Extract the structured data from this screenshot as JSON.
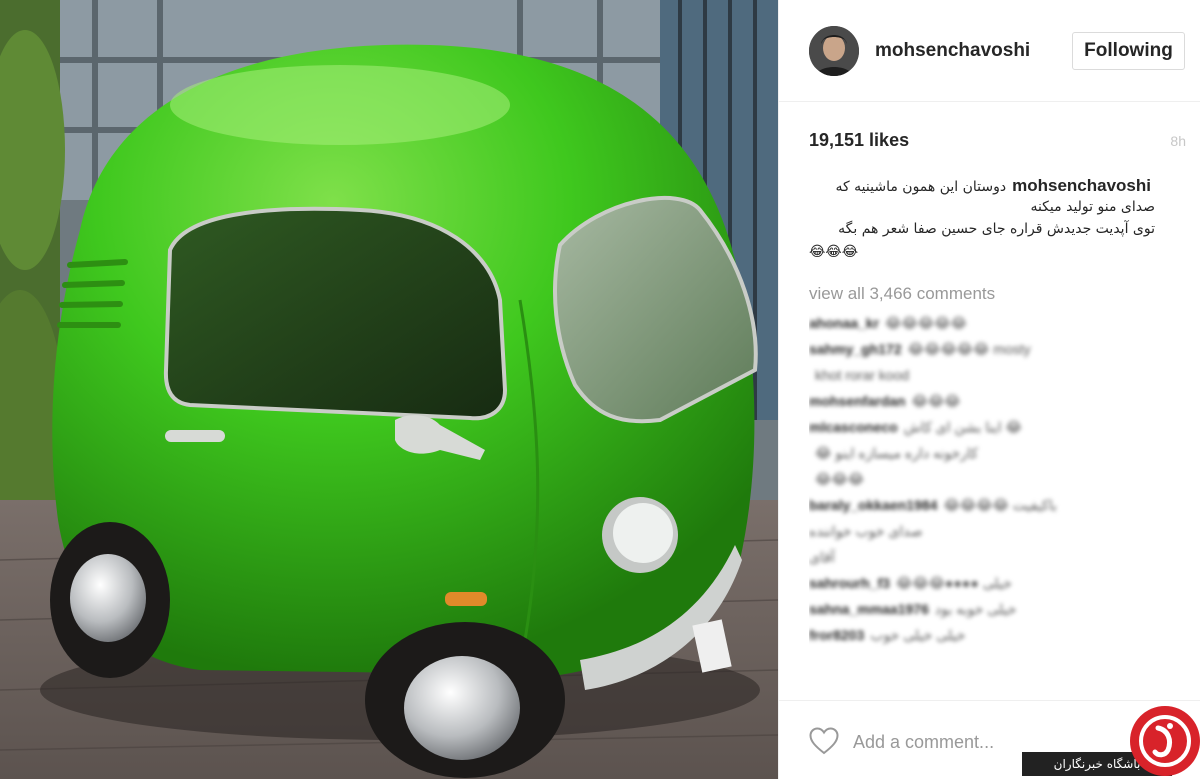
{
  "photo": {
    "alt_icon": "green-bubble-car-photo"
  },
  "header": {
    "username": "mohsenchavoshi",
    "follow_label": "Following"
  },
  "post": {
    "likes": "19,151 likes",
    "time_ago": "8h",
    "caption_user": "mohsenchavoshi",
    "caption_lines": [
      "دوستان این همون ماشینیه که",
      "صدای منو تولید میکنه",
      "توی آپدیت جدیدش قراره جای حسین صفا شعر هم بگه",
      "😂😂😂"
    ],
    "view_all": "view all 3,466 comments"
  },
  "comments": [
    {
      "user": "ahonaa_kr",
      "text": "😂😂😂😂😂"
    },
    {
      "user": "sahmy_gh172",
      "text": "😂😂😂😂😂 mosty"
    },
    {
      "user": "",
      "text": "khot rorar kood"
    },
    {
      "user": "mohsenfardan",
      "text": "😂😂😂"
    },
    {
      "user": "mlcasconeco",
      "text": "اینا بشن ای کاش 😂"
    },
    {
      "user": "",
      "text": "😂 کارخونه داره میسازه اینو"
    },
    {
      "user": "",
      "text": "😂😂😂"
    },
    {
      "user": "baraly_okkaen1984",
      "text": "😂😂😂😂 باکیفیت"
    },
    {
      "user": "",
      "text": "صدای خوب خواننده"
    },
    {
      "user": "",
      "text": "آقای"
    },
    {
      "user": "sahrourh_f3",
      "text": "😂😂😂●●●● خیلی"
    },
    {
      "user": "sahna_mmaa1976",
      "text": "خیلی خوبه بود"
    },
    {
      "user": "fror8203",
      "text": "خیلی خیلی خوب"
    }
  ],
  "footer": {
    "add_comment_placeholder": "Add a comment..."
  },
  "watermark": {
    "text": "باشگاه خبرنگاران"
  },
  "colors": {
    "car_green": "#3fc81e",
    "link_gray": "#999999",
    "watermark_red": "#d8232a"
  }
}
